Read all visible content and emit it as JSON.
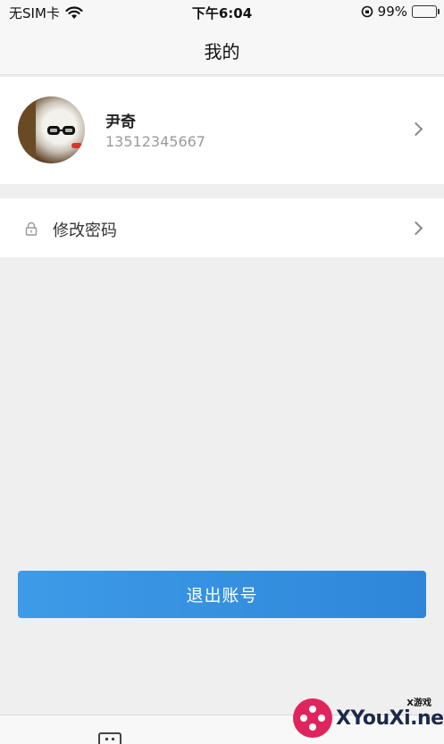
{
  "status_bar": {
    "carrier": "无SIM卡",
    "time": "下午6:04",
    "battery_percent": "99%",
    "battery_level": 0.99
  },
  "nav": {
    "title": "我的"
  },
  "profile": {
    "name": "尹奇",
    "phone": "13512345667"
  },
  "menu": {
    "items": [
      {
        "label": "修改密码",
        "icon": "lock-icon"
      }
    ]
  },
  "actions": {
    "logout_label": "退出账号"
  },
  "watermark": {
    "text": "XYouXi.net",
    "tag": "X游戏"
  },
  "colors": {
    "primary_button": "#3d9be8",
    "background": "#efefef",
    "battery": "#3bc44a"
  }
}
